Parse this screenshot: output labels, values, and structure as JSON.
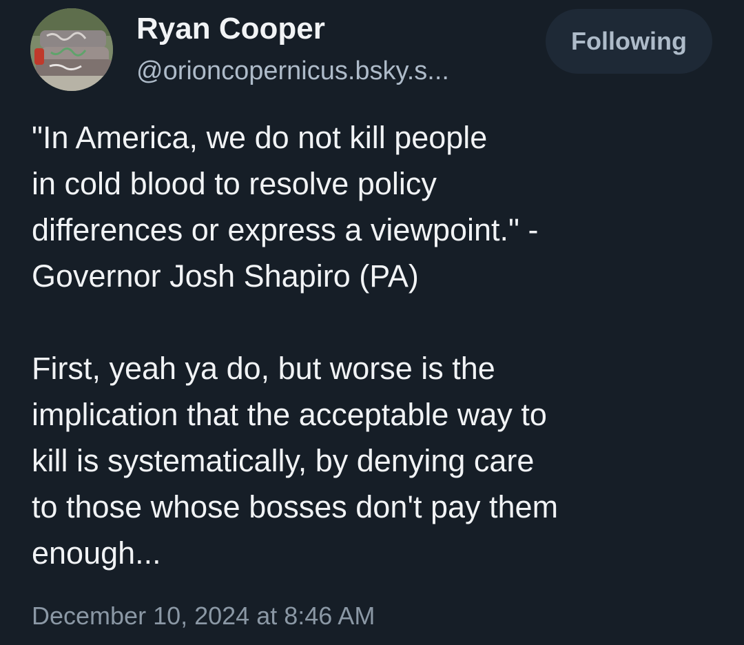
{
  "author": {
    "name": "Ryan Cooper",
    "handle": "@orioncopernicus.bsky.s..."
  },
  "follow_button": {
    "label": "Following"
  },
  "post": {
    "paragraphs": [
      "\"In America, we do not kill people\nin cold blood to resolve policy\ndifferences or express a viewpoint.\" -\nGovernor Josh Shapiro (PA)",
      "First, yeah ya do, but worse is the\nimplication that the acceptable way to\nkill is systematically, by denying care\nto those whose bosses don't pay them\nenough..."
    ],
    "timestamp": "December 10, 2024 at 8:46 AM"
  },
  "colors": {
    "background": "#161e27",
    "text_primary": "#f1f3f5",
    "text_secondary": "#aebbc9",
    "timestamp": "#8b98a5",
    "button_bg": "#1e2936"
  },
  "icons": {
    "avatar": "avatar-photo-graffiti-couch"
  }
}
